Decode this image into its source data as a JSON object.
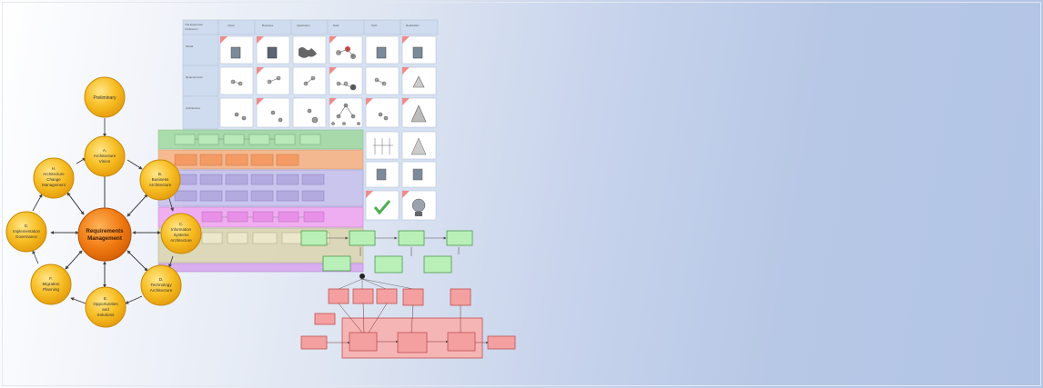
{
  "adm": {
    "hub": "Requirements Management",
    "phases": [
      {
        "id": "preliminary",
        "label": "Preliminary"
      },
      {
        "id": "a",
        "label": "A. Architecture Vision"
      },
      {
        "id": "b",
        "label": "B. Business Architecture"
      },
      {
        "id": "c",
        "label": "C. Information Systems Architecture"
      },
      {
        "id": "d",
        "label": "D. Technology Architecture"
      },
      {
        "id": "e",
        "label": "E. Opportunities and Solutions"
      },
      {
        "id": "f",
        "label": "F. Migration Planning"
      },
      {
        "id": "g",
        "label": "G. Implementation Governance"
      },
      {
        "id": "h",
        "label": "H. Architecture Change Management"
      }
    ]
  },
  "colors": {
    "phase_fill": "#f5b921",
    "phase_stroke": "#d99a08",
    "hub_fill": "#ee7a10",
    "grid_header": "#cfdcef",
    "layer_colors": [
      "#9fd89f",
      "#f7b486",
      "#c9c2ec",
      "#f0a8f0",
      "#dcd7b6",
      "#d9a9f0"
    ],
    "flow_green": "#b8f0b8",
    "flow_red": "#f4a0a0"
  },
  "icons": [
    "grid-icon",
    "map-icon",
    "network-icon",
    "tree-icon",
    "checkmark-icon",
    "bulb-icon"
  ]
}
